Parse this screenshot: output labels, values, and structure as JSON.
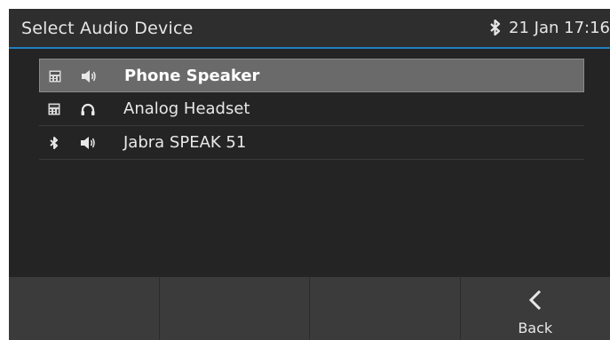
{
  "header": {
    "title": "Select Audio Device",
    "datetime": "21 Jan 17:16",
    "status_icon": "bluetooth-icon"
  },
  "devices": [
    {
      "type_icon": "phone-icon",
      "audio_icon": "speaker-icon",
      "label": "Phone Speaker",
      "selected": true
    },
    {
      "type_icon": "phone-icon",
      "audio_icon": "headset-icon",
      "label": "Analog Headset",
      "selected": false
    },
    {
      "type_icon": "bluetooth-icon",
      "audio_icon": "speaker-icon",
      "label": "Jabra SPEAK 51",
      "selected": false
    }
  ],
  "softkeys": {
    "back_label": "Back",
    "back_icon": "chevron-left-icon"
  },
  "colors": {
    "accent": "#1e7fc0",
    "background": "#242424",
    "selected_row": "#6a6a6a",
    "softkey_bar": "#3b3b3b"
  }
}
